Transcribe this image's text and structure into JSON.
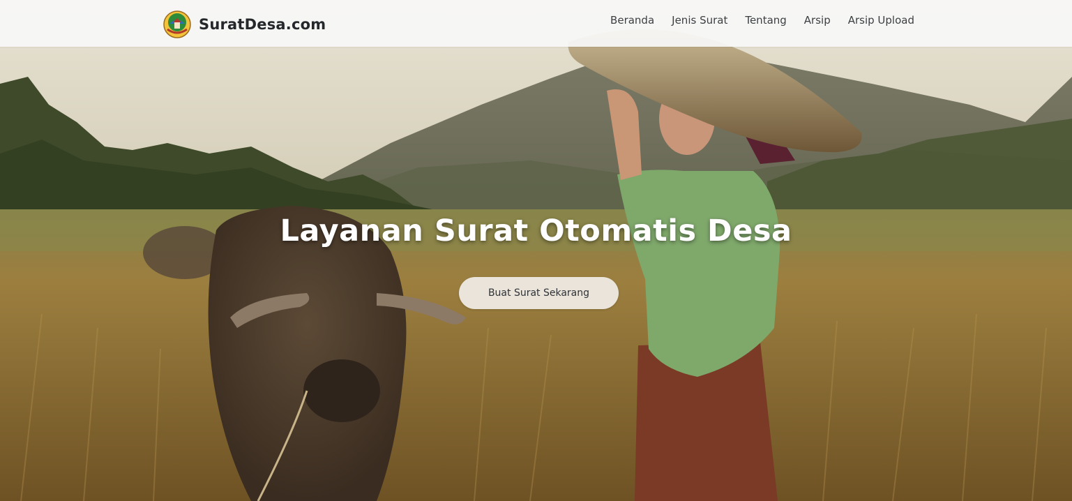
{
  "brand": {
    "name": "SuratDesa.com",
    "logo_icon": "village-emblem-icon"
  },
  "nav": {
    "items": [
      {
        "label": "Beranda"
      },
      {
        "label": "Jenis Surat"
      },
      {
        "label": "Tentang"
      },
      {
        "label": "Arsip"
      },
      {
        "label": "Arsip Upload"
      }
    ]
  },
  "hero": {
    "title": "Layanan Surat Otomatis Desa",
    "cta_label": "Buat Surat Sekarang",
    "background_image": "rice-field-woman-with-buffalo-photo"
  },
  "colors": {
    "navbar_bg": "#f7f7f7",
    "brand_text": "#25282b",
    "nav_text": "#3c3f42",
    "hero_title": "#ffffff",
    "cta_bg": "#f0ece6",
    "cta_text": "#2f3236"
  }
}
